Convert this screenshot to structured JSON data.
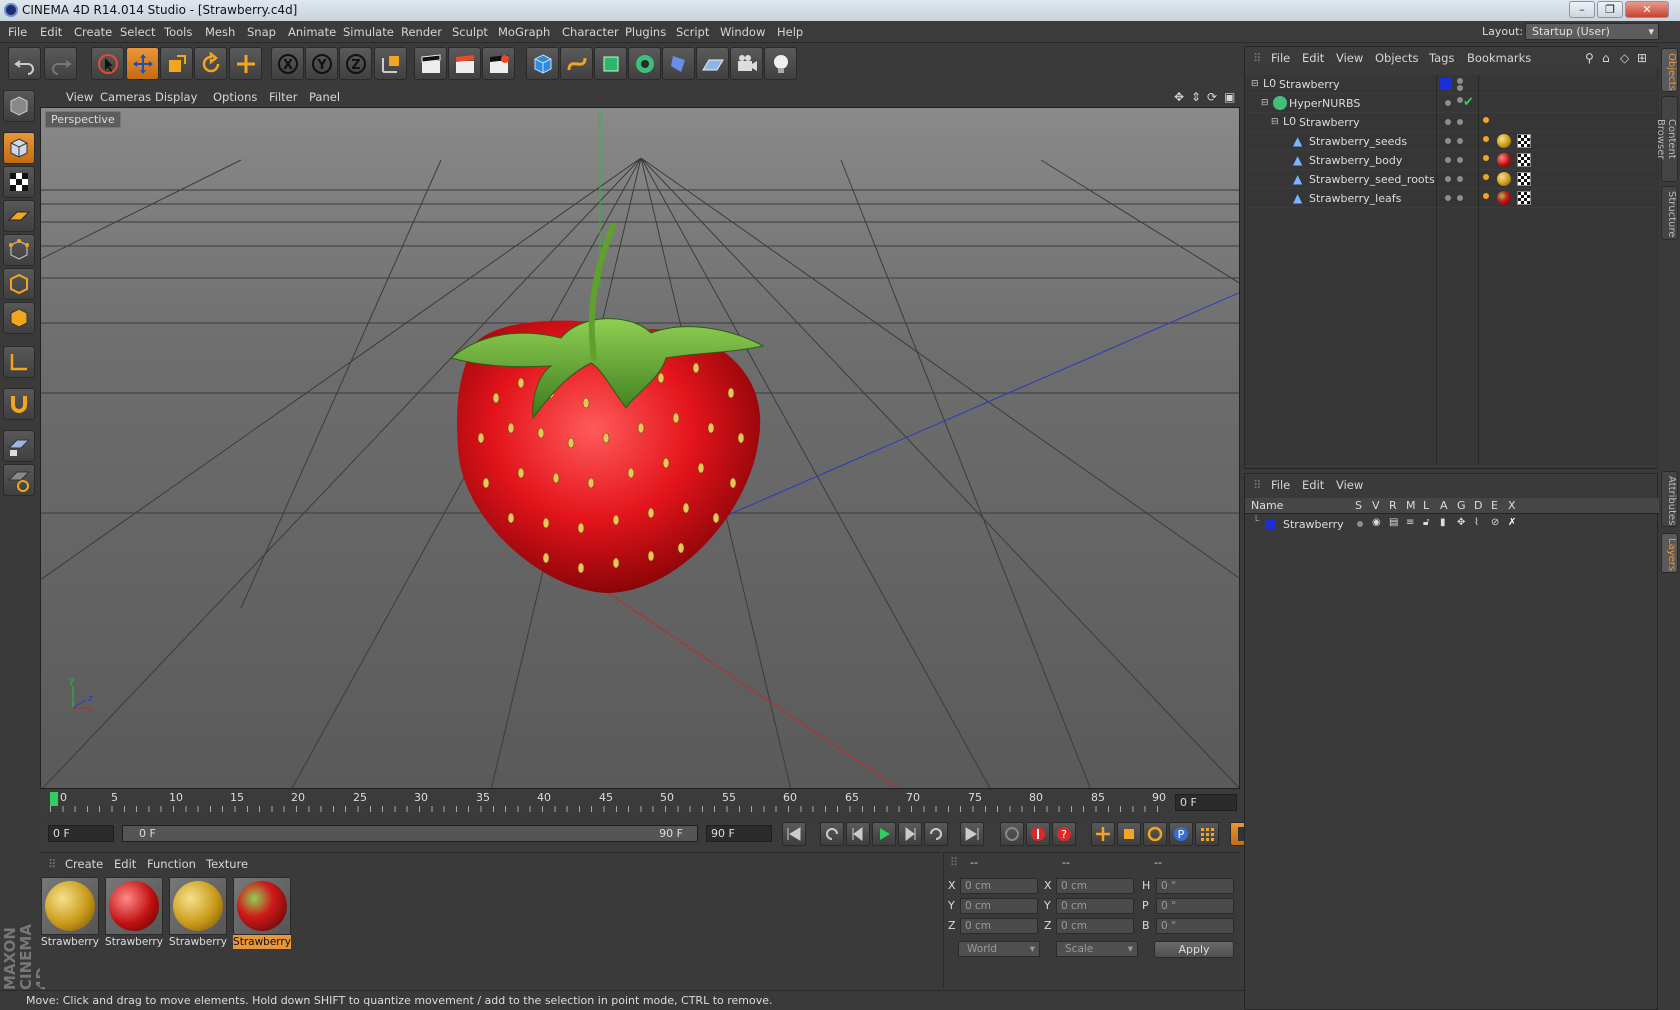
{
  "window": {
    "title": "CINEMA 4D R14.014 Studio - [Strawberry.c4d]",
    "minimize": "–",
    "restore": "❐",
    "close": "✕"
  },
  "menu": [
    "File",
    "Edit",
    "Create",
    "Select",
    "Tools",
    "Mesh",
    "Snap",
    "Animate",
    "Simulate",
    "Render",
    "Sculpt",
    "MoGraph",
    "Character",
    "Plugins",
    "Script",
    "Window",
    "Help"
  ],
  "layout": {
    "label": "Layout:",
    "value": "Startup (User)"
  },
  "viewport": {
    "menu": [
      "View",
      "Cameras",
      "Display",
      "Options",
      "Filter",
      "Panel"
    ],
    "label": "Perspective",
    "axis": {
      "y": "y",
      "z": "z",
      "x": "x"
    }
  },
  "timeline": {
    "ticks": [
      "0",
      "5",
      "10",
      "15",
      "20",
      "25",
      "30",
      "35",
      "40",
      "45",
      "50",
      "55",
      "60",
      "65",
      "70",
      "75",
      "80",
      "85",
      "90"
    ],
    "current_frame": "0 F"
  },
  "transport": {
    "start": "0 F",
    "range_start": "0 F",
    "range_end": "90 F",
    "end": "90 F"
  },
  "materials": {
    "menu": [
      "Create",
      "Edit",
      "Function",
      "Texture"
    ],
    "items": [
      {
        "label": "Strawberry",
        "kind": "seed-yellow",
        "selected": false
      },
      {
        "label": "Strawberry",
        "kind": "body-red",
        "selected": false
      },
      {
        "label": "Strawberry",
        "kind": "seed-yellow",
        "selected": false
      },
      {
        "label": "Strawberry",
        "kind": "leaf-red",
        "selected": true
      }
    ]
  },
  "coordinates": {
    "headers": [
      "--",
      "--",
      "--"
    ],
    "rows": [
      {
        "a": "X",
        "av": "0 cm",
        "b": "X",
        "bv": "0 cm",
        "c": "H",
        "cv": "0 °"
      },
      {
        "a": "Y",
        "av": "0 cm",
        "b": "Y",
        "bv": "0 cm",
        "c": "P",
        "cv": "0 °"
      },
      {
        "a": "Z",
        "av": "0 cm",
        "b": "Z",
        "bv": "0 cm",
        "c": "B",
        "cv": "0 °"
      }
    ],
    "mode": "World",
    "size_mode": "Scale",
    "apply": "Apply"
  },
  "status": "Move: Click and drag to move elements. Hold down SHIFT to quantize movement / add to the selection in point mode, CTRL to remove.",
  "objects": {
    "menu": [
      "File",
      "Edit",
      "View",
      "Objects",
      "Tags",
      "Bookmarks"
    ],
    "tree": [
      {
        "name": "Strawberry",
        "depth": 0,
        "icon": "null-icon"
      },
      {
        "name": "HyperNURBS",
        "depth": 1,
        "icon": "hypernurbs-icon"
      },
      {
        "name": "Strawberry",
        "depth": 2,
        "icon": "null-icon"
      },
      {
        "name": "Strawberry_seeds",
        "depth": 3,
        "icon": "polygon-icon"
      },
      {
        "name": "Strawberry_body",
        "depth": 3,
        "icon": "polygon-icon"
      },
      {
        "name": "Strawberry_seed_roots",
        "depth": 3,
        "icon": "polygon-icon"
      },
      {
        "name": "Strawberry_leafs",
        "depth": 3,
        "icon": "polygon-icon"
      }
    ]
  },
  "layers": {
    "menu": [
      "File",
      "Edit",
      "View"
    ],
    "columns": [
      "Name",
      "S",
      "V",
      "R",
      "M",
      "L",
      "A",
      "G",
      "D",
      "E",
      "X"
    ],
    "rows": [
      {
        "name": "Strawberry",
        "color": "#1a2fd6"
      }
    ]
  },
  "right_tabs": [
    "Objects",
    "Content Browser",
    "Structure",
    "Attributes",
    "Layers"
  ],
  "brand": "MAXON CINEMA 4D",
  "colors": {
    "accent": "#e9963b",
    "panel": "#3a3a3a",
    "layer": "#1a2fd6"
  }
}
